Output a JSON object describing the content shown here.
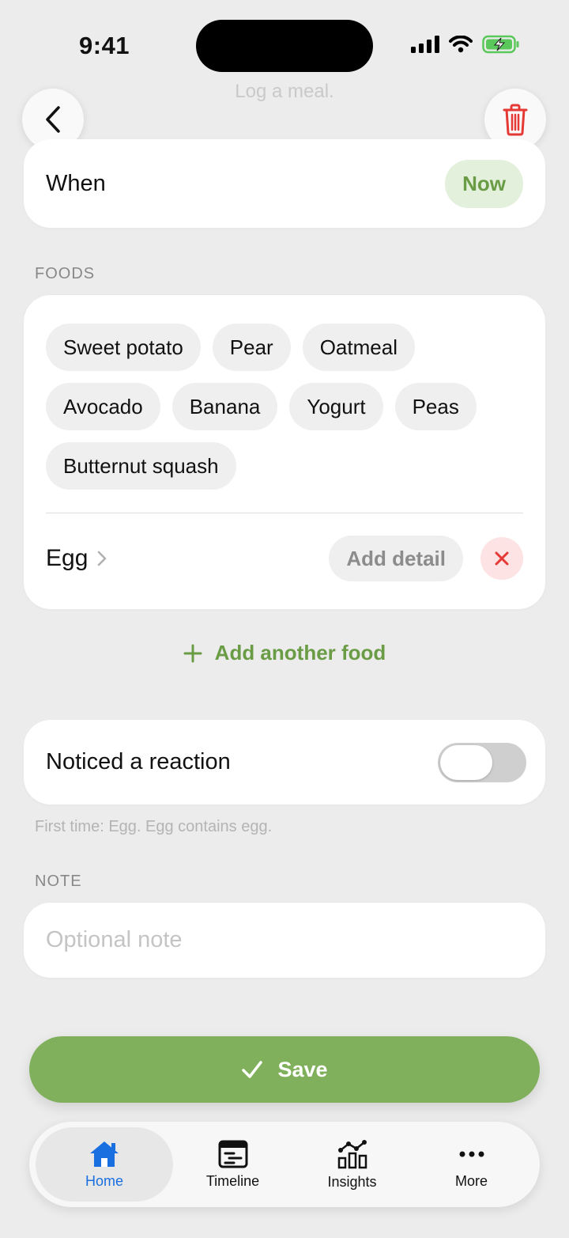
{
  "status_bar": {
    "time": "9:41"
  },
  "header": {
    "title": "Log a meal."
  },
  "when": {
    "label": "When",
    "value": "Now"
  },
  "foods": {
    "section_label": "FOODS",
    "chips": [
      "Sweet potato",
      "Pear",
      "Oatmeal",
      "Avocado",
      "Banana",
      "Yogurt",
      "Peas",
      "Butternut squash"
    ],
    "selected": {
      "name": "Egg",
      "add_detail_label": "Add detail"
    },
    "add_another_label": "Add another food"
  },
  "reaction": {
    "label": "Noticed a reaction",
    "enabled": false
  },
  "hint": "First time: Egg. Egg contains egg.",
  "note": {
    "section_label": "NOTE",
    "placeholder": "Optional note",
    "value": ""
  },
  "save_label": "Save",
  "tabs": [
    {
      "label": "Home",
      "icon": "house-icon",
      "active": true
    },
    {
      "label": "Timeline",
      "icon": "timeline-icon",
      "active": false
    },
    {
      "label": "Insights",
      "icon": "insights-icon",
      "active": false
    },
    {
      "label": "More",
      "icon": "more-icon",
      "active": false
    }
  ],
  "colors": {
    "accent_green": "#80b05b",
    "now_green": "#6a9b45",
    "danger_red": "#e53935",
    "tab_active_blue": "#1a6fe0"
  }
}
